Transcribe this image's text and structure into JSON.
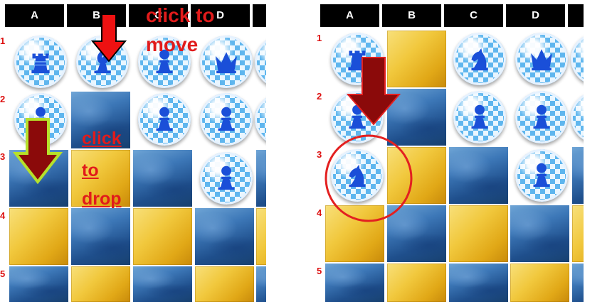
{
  "colors": {
    "header_bg": "#000000",
    "header_text": "#ffffff",
    "row_label": "#dd1111",
    "annotation_red": "#e11b1b",
    "arrow_dark_red": "#8b0a0a",
    "arrow_outline_green": "#b6e12b",
    "circle_red": "#e32020"
  },
  "columns": [
    "A",
    "B",
    "C",
    "D"
  ],
  "rows": [
    "1",
    "2",
    "3",
    "4",
    "5"
  ],
  "left_board": {
    "annotations": {
      "move_line1": "click to",
      "move_line2": "move",
      "drop_line1": "click",
      "drop_line2": "to",
      "drop_line3": "drop"
    },
    "pieces": {
      "r1_a": "rook",
      "r1_b": "bishop",
      "r1_c": "pawn",
      "r1_d": "queen",
      "r2_a": "pawn",
      "r2_c": "pawn",
      "r2_d": "pawn",
      "r3_d": "pawn"
    }
  },
  "right_board": {
    "pieces": {
      "r1_a": "rook",
      "r1_c": "knight",
      "r1_d": "queen",
      "r2_a": "pawn",
      "r2_c": "pawn",
      "r2_d": "pawn",
      "r3_a": "knight",
      "r3_d": "pawn"
    }
  }
}
